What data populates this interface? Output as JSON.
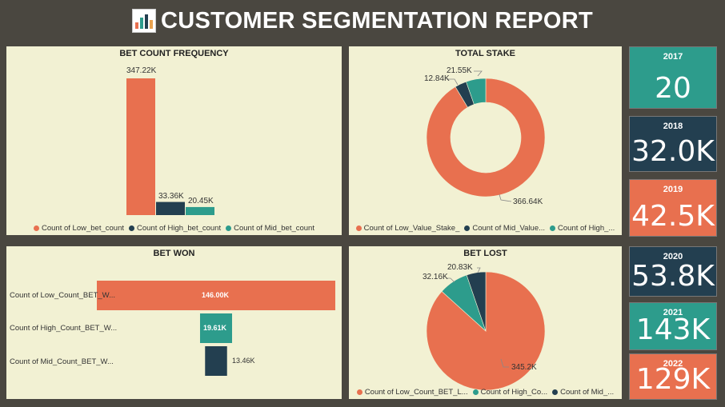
{
  "header": {
    "title": "CUSTOMER SEGMENTATION REPORT",
    "icon": "bar-chart-icon"
  },
  "colors": {
    "orange": "#e8704f",
    "navy": "#233f50",
    "teal": "#2d9c8c",
    "panel": "#f2f1d3",
    "bg": "#4a4740"
  },
  "charts": {
    "bet_count_frequency": {
      "title": "BET COUNT FREQUENCY",
      "value_labels": [
        "347.22K",
        "33.36K",
        "20.45K"
      ],
      "legend": [
        "Count of Low_bet_count",
        "Count of High_bet_count",
        "Count of Mid_bet_count"
      ]
    },
    "total_stake": {
      "title": "TOTAL STAKE",
      "value_labels": [
        "366.64K",
        "12.84K",
        "21.55K"
      ],
      "legend": [
        "Count of Low_Value_Stake_",
        "Count of Mid_Value...",
        "Count of High_..."
      ]
    },
    "bet_won": {
      "title": "BET WON",
      "categories": [
        "Count of Low_Count_BET_W...",
        "Count of High_Count_BET_W...",
        "Count of Mid_Count_BET_W..."
      ],
      "value_labels": [
        "146.00K",
        "19.61K",
        "13.46K"
      ]
    },
    "bet_lost": {
      "title": "BET LOST",
      "value_labels": [
        "345.2K",
        "32.16K",
        "20.83K"
      ],
      "legend": [
        "Count of Low_Count_BET_L...",
        "Count of High_Co...",
        "Count of Mid_..."
      ]
    }
  },
  "chart_data": [
    {
      "type": "bar",
      "title": "BET COUNT FREQUENCY",
      "categories": [
        "Count of Low_bet_count",
        "Count of High_bet_count",
        "Count of Mid_bet_count"
      ],
      "values": [
        347220,
        33360,
        20450
      ],
      "colors": [
        "#e8704f",
        "#233f50",
        "#2d9c8c"
      ]
    },
    {
      "type": "pie",
      "title": "TOTAL STAKE",
      "donut": true,
      "categories": [
        "Count of Low_Value_Stake_",
        "Count of Mid_Value...",
        "Count of High_..."
      ],
      "values": [
        366640,
        12840,
        21550
      ],
      "colors": [
        "#e8704f",
        "#233f50",
        "#2d9c8c"
      ]
    },
    {
      "type": "bar",
      "orientation": "horizontal",
      "title": "BET WON",
      "categories": [
        "Count of Low_Count_BET_W...",
        "Count of High_Count_BET_W...",
        "Count of Mid_Count_BET_W..."
      ],
      "values": [
        146000,
        19610,
        13460
      ],
      "colors": [
        "#e8704f",
        "#2d9c8c",
        "#233f50"
      ]
    },
    {
      "type": "pie",
      "title": "BET LOST",
      "categories": [
        "Count of Low_Count_BET_L...",
        "Count of High_Co...",
        "Count of Mid_..."
      ],
      "values": [
        345200,
        32160,
        20830
      ],
      "colors": [
        "#e8704f",
        "#2d9c8c",
        "#233f50"
      ]
    }
  ],
  "cards": [
    {
      "year": "2017",
      "value": "20",
      "color": "#2d9c8c"
    },
    {
      "year": "2018",
      "value": "32.0K",
      "color": "#233f50"
    },
    {
      "year": "2019",
      "value": "42.5K",
      "color": "#e8704f"
    },
    {
      "year": "2020",
      "value": "53.8K",
      "color": "#233f50"
    },
    {
      "year": "2021",
      "value": "143K",
      "color": "#2d9c8c"
    },
    {
      "year": "2022",
      "value": "129K",
      "color": "#e8704f"
    }
  ]
}
